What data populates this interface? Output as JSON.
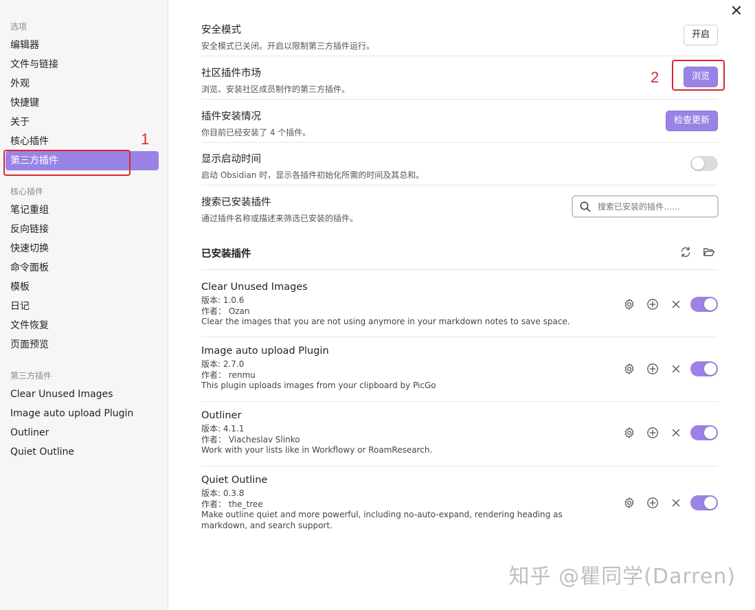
{
  "sidebar": {
    "options_header": "选项",
    "options_items": [
      "编辑器",
      "文件与链接",
      "外观",
      "快捷键",
      "关于",
      "核心插件",
      "第三方插件"
    ],
    "core_header": "核心插件",
    "core_items": [
      "笔记重组",
      "反向链接",
      "快速切换",
      "命令面板",
      "模板",
      "日记",
      "文件恢复",
      "页面预览"
    ],
    "third_header": "第三方插件",
    "third_items": [
      "Clear Unused Images",
      "Image auto upload Plugin",
      "Outliner",
      "Quiet Outline"
    ]
  },
  "annotations": {
    "one": "1",
    "two": "2",
    "color": "#d9262b"
  },
  "settings": {
    "safe_mode": {
      "title": "安全模式",
      "desc": "安全模式已关闭。开启以限制第三方插件运行。",
      "button": "开启"
    },
    "community": {
      "title": "社区插件市场",
      "desc": "浏览、安装社区成员制作的第三方插件。",
      "button": "浏览"
    },
    "installed_info": {
      "title": "插件安装情况",
      "desc": "你目前已经安装了 4 个插件。",
      "button": "检查更新"
    },
    "startup_time": {
      "title": "显示启动时间",
      "desc": "启动 Obsidian 时，显示各插件初始化所需的时间及其总和。",
      "toggle": "off"
    },
    "search": {
      "title": "搜索已安装插件",
      "desc": "通过插件名称或描述来筛选已安装的插件。",
      "placeholder": "搜索已安装的插件……"
    }
  },
  "installed": {
    "title": "已安装插件",
    "plugins": [
      {
        "name": "Clear Unused Images",
        "version": "版本: 1.0.6",
        "author": "作者：  Ozan",
        "desc": "Clear the images that you are not using anymore in your markdown notes to save space.",
        "enabled": true
      },
      {
        "name": "Image auto upload Plugin",
        "version": "版本: 2.7.0",
        "author": "作者：  renmu",
        "desc": "This plugin uploads images from your clipboard by PicGo",
        "enabled": true
      },
      {
        "name": "Outliner",
        "version": "版本: 4.1.1",
        "author": "作者：  Viacheslav Slinko",
        "desc": "Work with your lists like in Workflowy or RoamResearch.",
        "enabled": true
      },
      {
        "name": "Quiet Outline",
        "version": "版本: 0.3.8",
        "author": "作者：  the_tree",
        "desc": "Make outline quiet and more powerful, including no-auto-expand, rendering heading as markdown, and search support.",
        "enabled": true
      }
    ]
  },
  "icons": {
    "close": "close-icon",
    "refresh": "refresh-icon",
    "folder": "folder-open-icon",
    "settings": "gear-icon",
    "hotkey": "plus-circle-icon",
    "uninstall": "x-icon",
    "search": "search-icon"
  },
  "colors": {
    "accent": "#9b83e6",
    "sidebar_bg": "#f6f6f6",
    "annotation": "#d9262b"
  },
  "watermark": "知乎 @瞿同学(Darren)"
}
